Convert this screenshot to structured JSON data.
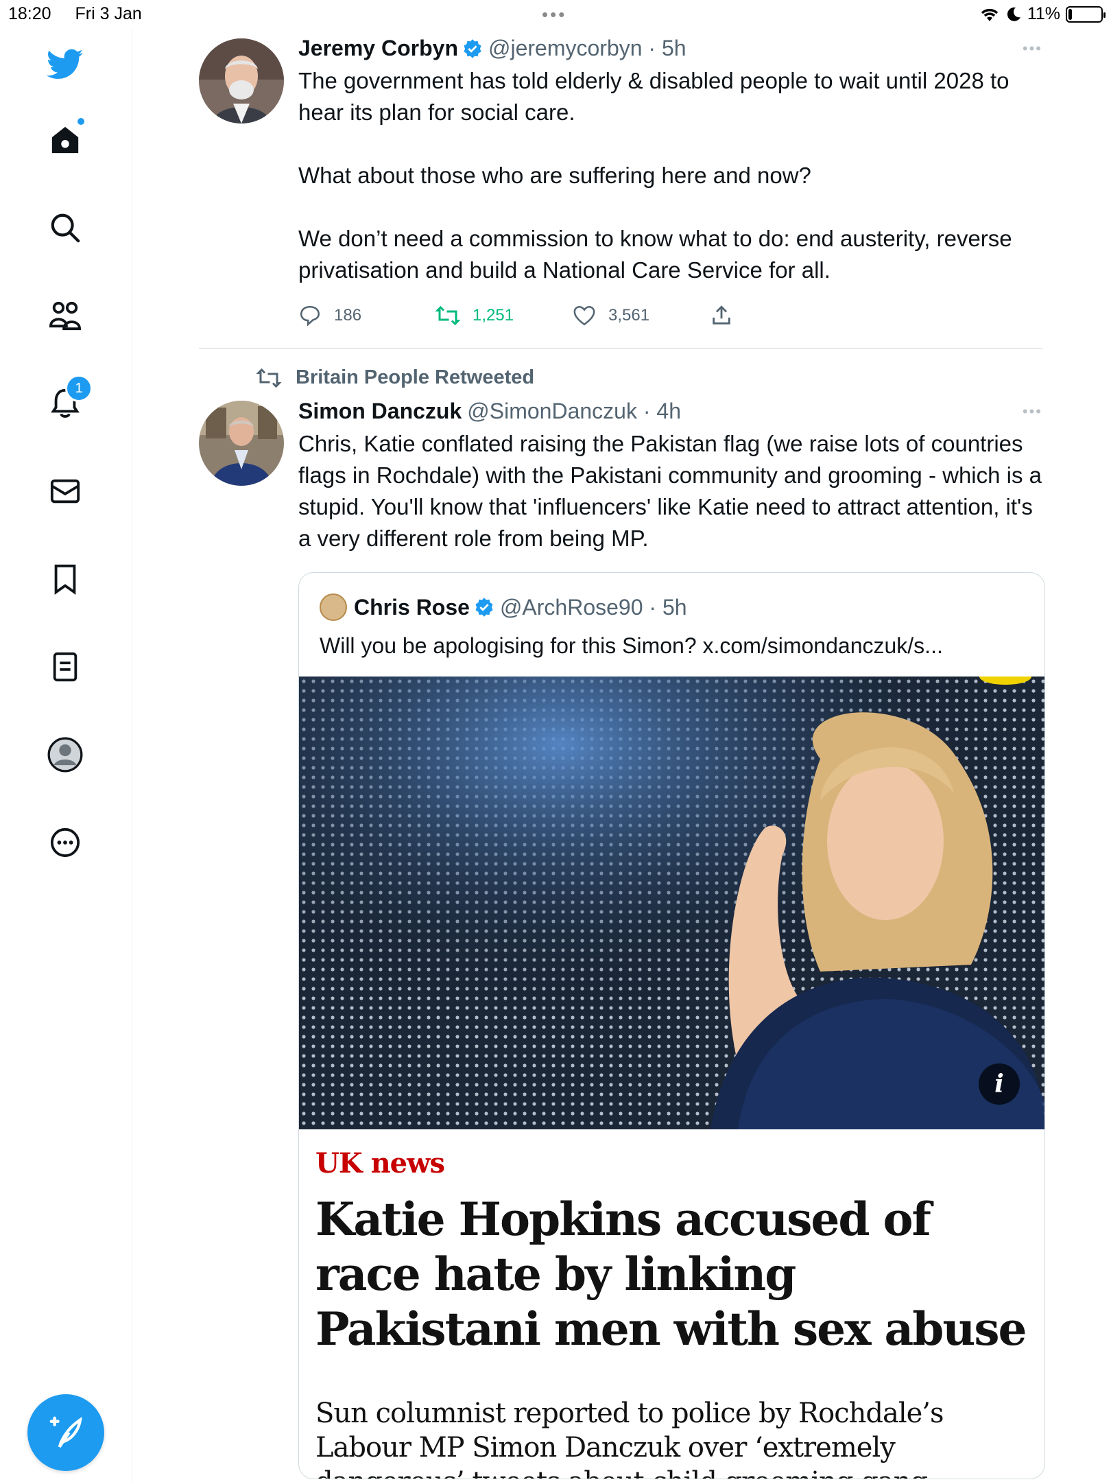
{
  "status_bar": {
    "time": "18:20",
    "date": "Fri 3 Jan",
    "battery": "11%",
    "battery_level": 0.11
  },
  "sidebar": {
    "items": [
      {
        "icon": "twitter-logo-icon"
      },
      {
        "icon": "home-icon",
        "has_dot": true
      },
      {
        "icon": "search-icon"
      },
      {
        "icon": "communities-icon"
      },
      {
        "icon": "notifications-icon",
        "badge": "1"
      },
      {
        "icon": "messages-icon"
      },
      {
        "icon": "bookmarks-icon"
      },
      {
        "icon": "lists-icon"
      },
      {
        "icon": "profile-icon"
      },
      {
        "icon": "more-icon"
      }
    ],
    "compose_icon": "compose-icon"
  },
  "tweets": [
    {
      "display_name": "Jeremy Corbyn",
      "handle": "@jeremycorbyn · 5h",
      "verified": true,
      "text": "The government has told elderly & disabled people to wait until 2028 to hear its plan for social care.\n\nWhat about those who are suffering here and now?\n\nWe don’t need a commission to know what to do: end austerity, reverse privatisation and build a National Care Service for all.",
      "replies": "186",
      "retweets": "1,251",
      "likes": "3,561",
      "more": "•••"
    },
    {
      "retweeted_by": "Britain People Retweeted",
      "display_name": "Simon Danczuk",
      "handle": "@SimonDanczuk · 4h",
      "text": "Chris, Katie conflated raising the Pakistan flag (we raise lots of countries flags in Rochdale) with the Pakistani community and grooming - which is a stupid. You'll know that 'influencers' like Katie need to attract attention, it's a very different role from being MP.",
      "more": "•••",
      "quote": {
        "display_name": "Chris Rose",
        "handle": "@ArchRose90 · 5h",
        "verified": true,
        "text": "Will you be apologising for this Simon? x.com/simondanczuk/s...",
        "image_info": "i",
        "news_section": "UK news",
        "news_headline": "Katie Hopkins accused of race hate by linking Pakistani men with sex abuse",
        "news_standfirst": "Sun columnist reported to police by Rochdale’s Labour MP Simon Danczuk over ‘extremely dangerous’ tweets about child grooming gang"
      }
    }
  ],
  "colors": {
    "accent": "#1d9bf0",
    "retweet_green": "#00ba7c",
    "news_red": "#c70000"
  }
}
